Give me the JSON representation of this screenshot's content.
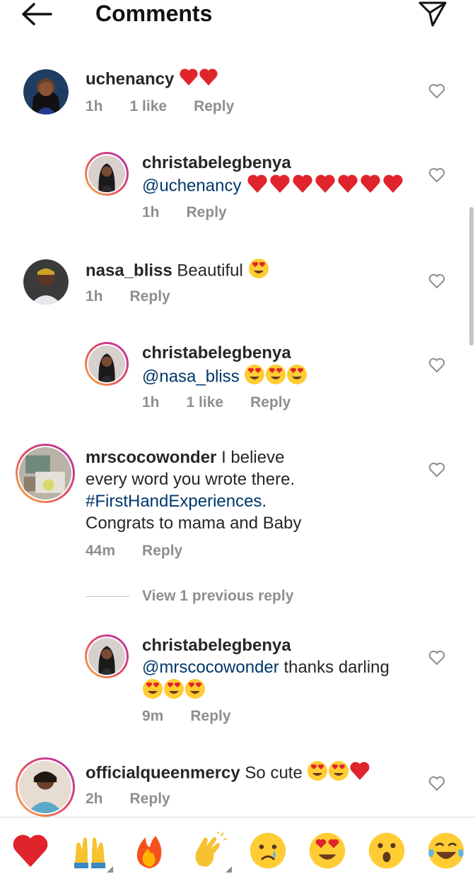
{
  "header": {
    "title": "Comments"
  },
  "comments": [
    {
      "username": "uchenancy",
      "text": "",
      "emoji": [
        "red-heart",
        "red-heart"
      ],
      "time": "1h",
      "likes": "1 like",
      "reply": "Reply"
    },
    {
      "username": "christabelegbenya",
      "mention": "@uchenancy",
      "emoji": [
        "red-heart",
        "red-heart",
        "red-heart",
        "red-heart",
        "red-heart",
        "red-heart",
        "red-heart"
      ],
      "time": "1h",
      "reply": "Reply"
    },
    {
      "username": "nasa_bliss",
      "text": "Beautiful",
      "emoji": [
        "heart-eyes"
      ],
      "time": "1h",
      "reply": "Reply"
    },
    {
      "username": "christabelegbenya",
      "mention": "@nasa_bliss",
      "emoji": [
        "heart-eyes",
        "heart-eyes",
        "heart-eyes"
      ],
      "time": "1h",
      "likes": "1 like",
      "reply": "Reply"
    },
    {
      "username": "mrscocowonder",
      "text_line1": "I believe",
      "text_line2": "every word you wrote there.",
      "hashtag": "#FirstHandExperiences",
      "text_after_hashtag": ".",
      "text_line4": "Congrats to mama and Baby",
      "time": "44m",
      "reply": "Reply"
    },
    {
      "username": "christabelegbenya",
      "mention": "@mrscocowonder",
      "text": "thanks darling",
      "emoji": [
        "heart-eyes",
        "heart-eyes",
        "heart-eyes"
      ],
      "time": "9m",
      "reply": "Reply"
    },
    {
      "username": "officialqueenmercy",
      "text": "So cute",
      "emoji": [
        "heart-eyes",
        "heart-eyes",
        "red-heart"
      ],
      "time": "2h",
      "reply": "Reply"
    }
  ],
  "view_previous": "View 1 previous reply",
  "reactions": [
    "red-heart",
    "raising-hands",
    "fire",
    "clapping-hands",
    "crying-face",
    "heart-eyes",
    "surprised-face",
    "tears-of-joy"
  ]
}
